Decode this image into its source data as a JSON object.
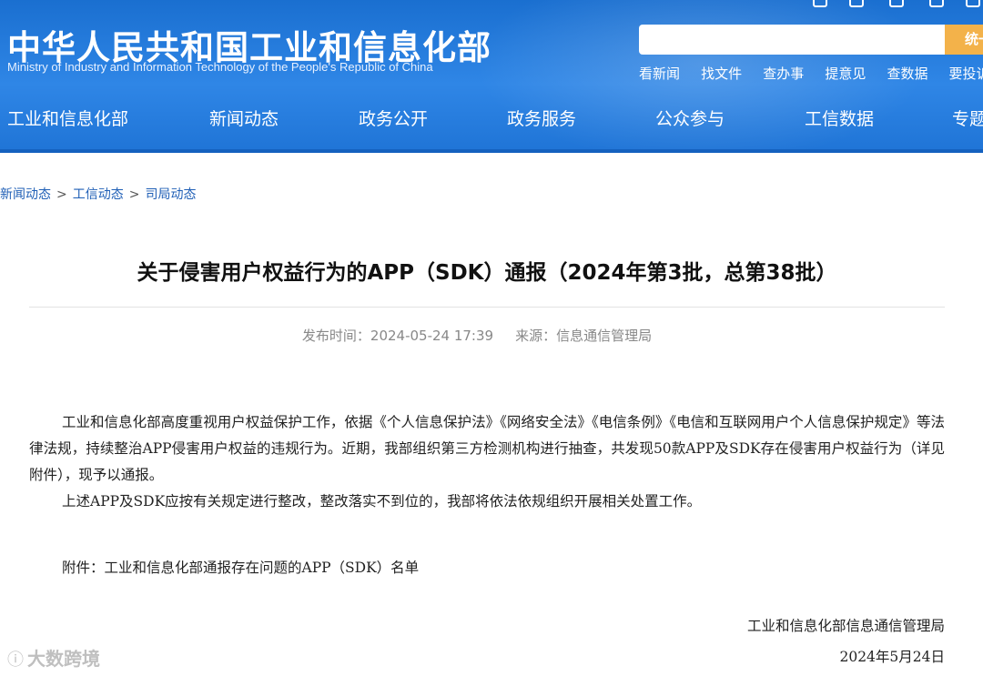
{
  "header": {
    "title_cn": "中华人民共和国工业和信息化部",
    "title_en": "Ministry of Industry and Information Technology of the People's Republic of China",
    "search_button": "统一",
    "search_placeholder": "",
    "quick_links": [
      "看新闻",
      "找文件",
      "查办事",
      "提意见",
      "查数据",
      "要投诉"
    ]
  },
  "nav": {
    "items": [
      "工业和信息化部",
      "新闻动态",
      "政务公开",
      "政务服务",
      "公众参与",
      "工信数据",
      "专题"
    ]
  },
  "breadcrumb": [
    "新闻动态",
    "工信动态",
    "司局动态"
  ],
  "breadcrumb_sep": ">",
  "article": {
    "title": "关于侵害用户权益行为的APP（SDK）通报（2024年第3批，总第38批）",
    "publish_label": "发布时间：2024-05-24 17:39",
    "source_label": "来源：信息通信管理局",
    "paragraphs": [
      "工业和信息化部高度重视用户权益保护工作，依据《个人信息保护法》《网络安全法》《电信条例》《电信和互联网用户个人信息保护规定》等法律法规，持续整治APP侵害用户权益的违规行为。近期，我部组织第三方检测机构进行抽查，共发现50款APP及SDK存在侵害用户权益行为（详见附件），现予以通报。",
      "上述APP及SDK应按有关规定进行整改，整改落实不到位的，我部将依法依规组织开展相关处置工作。"
    ],
    "attachment": "附件：工业和信息化部通报存在问题的APP（SDK）名单",
    "sign_org": "工业和信息化部信息通信管理局",
    "sign_date": "2024年5月24日"
  },
  "watermark": "大数跨境",
  "colors": {
    "header_blue": "#2f86e6",
    "link_blue": "#1f5fb6",
    "search_orange": "#f3b24a"
  }
}
